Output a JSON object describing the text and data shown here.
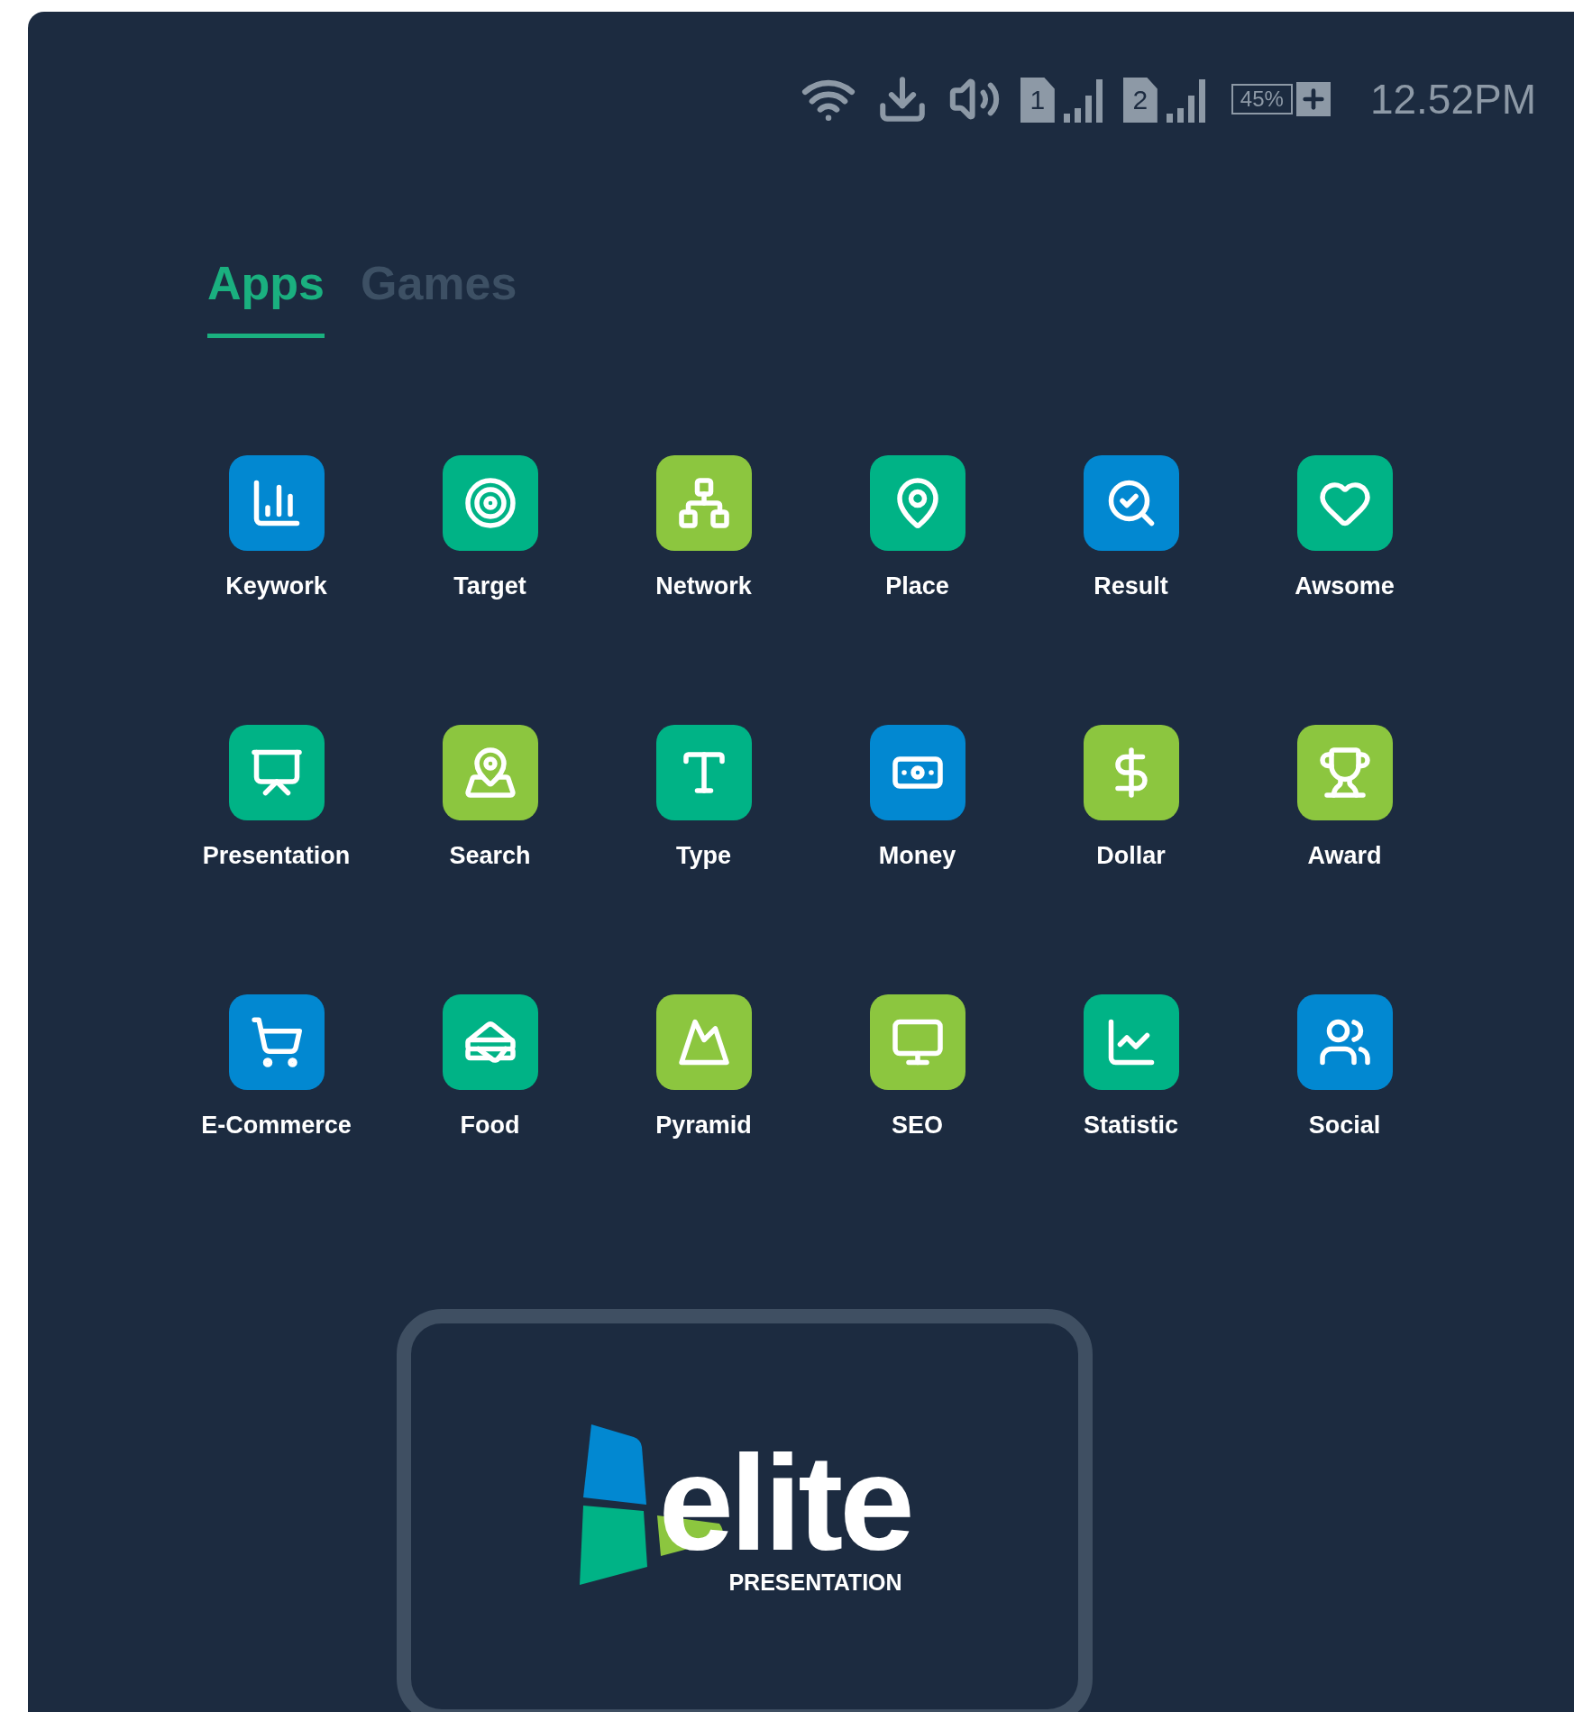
{
  "status_bar": {
    "sim_slots": [
      "1",
      "2"
    ],
    "battery": "45%",
    "time": "12.52PM"
  },
  "tabs": [
    {
      "label": "Apps",
      "selected": true
    },
    {
      "label": "Games",
      "selected": false
    }
  ],
  "apps": [
    {
      "label": "Keywork",
      "color": "#0288d1"
    },
    {
      "label": "Target",
      "color": "#00b386"
    },
    {
      "label": "Network",
      "color": "#8cc63f"
    },
    {
      "label": "Place",
      "color": "#00b386"
    },
    {
      "label": "Result",
      "color": "#0288d1"
    },
    {
      "label": "Awsome",
      "color": "#00b386"
    },
    {
      "label": "Presentation",
      "color": "#00b386"
    },
    {
      "label": "Search",
      "color": "#8cc63f"
    },
    {
      "label": "Type",
      "color": "#00b386"
    },
    {
      "label": "Money",
      "color": "#0288d1"
    },
    {
      "label": "Dollar",
      "color": "#8cc63f"
    },
    {
      "label": "Award",
      "color": "#8cc63f"
    },
    {
      "label": "E-Commerce",
      "color": "#0288d1"
    },
    {
      "label": "Food",
      "color": "#00b386"
    },
    {
      "label": "Pyramid",
      "color": "#8cc63f"
    },
    {
      "label": "SEO",
      "color": "#8cc63f"
    },
    {
      "label": "Statistic",
      "color": "#00b386"
    },
    {
      "label": "Social",
      "color": "#0288d1"
    }
  ],
  "logo": {
    "wordmark": "elite",
    "tagline": "PRESENTATION"
  }
}
